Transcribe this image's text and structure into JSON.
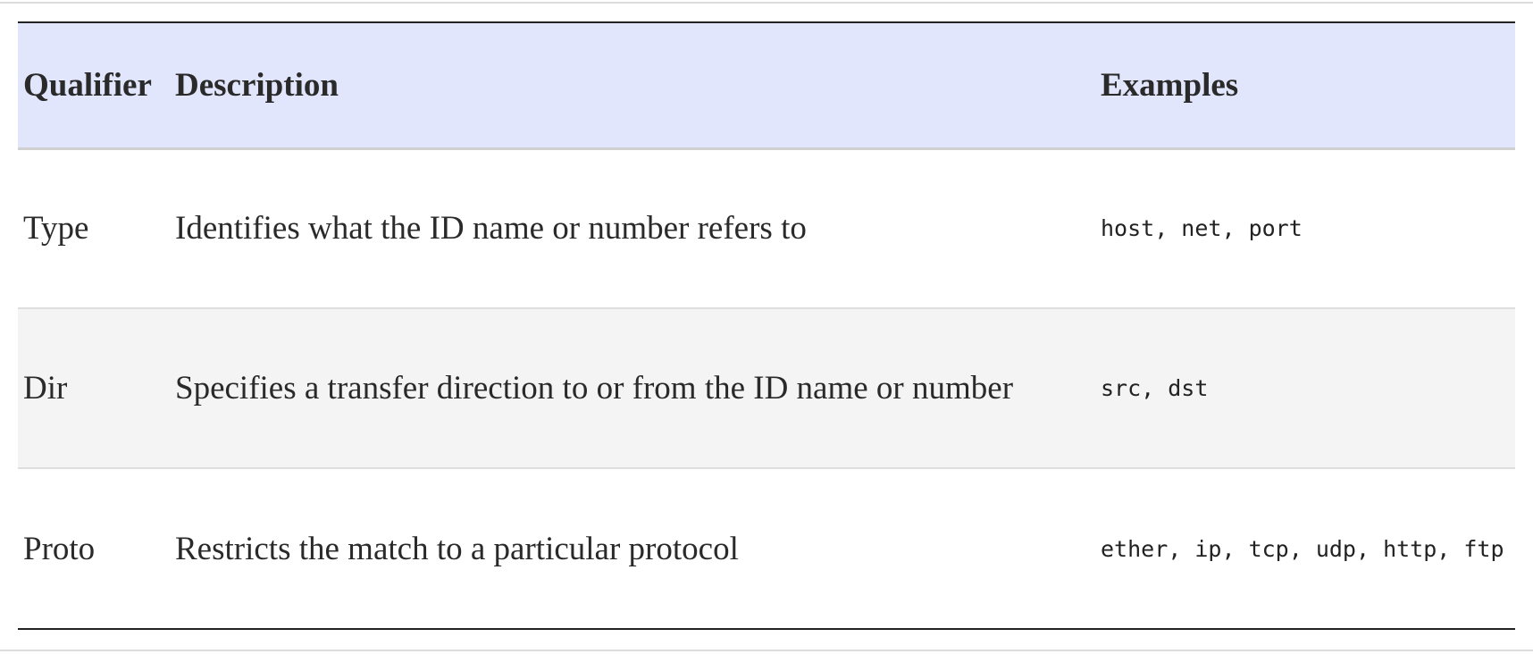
{
  "table": {
    "headers": {
      "qualifier": "Qualifier",
      "description": "Description",
      "examples": "Examples"
    },
    "rows": [
      {
        "qualifier": "Type",
        "description": "Identifies what the ID name or number refers to",
        "examples": "host, net, port"
      },
      {
        "qualifier": "Dir",
        "description": "Specifies a transfer direction to or from the ID name or number",
        "examples": "src, dst"
      },
      {
        "qualifier": "Proto",
        "description": "Restricts the match to a particular protocol",
        "examples": "ether, ip, tcp, udp, http, ftp"
      }
    ]
  },
  "colors": {
    "header_background": "#e1e6fc",
    "alt_row_background": "#f4f4f4",
    "text": "#2a2a2a"
  }
}
